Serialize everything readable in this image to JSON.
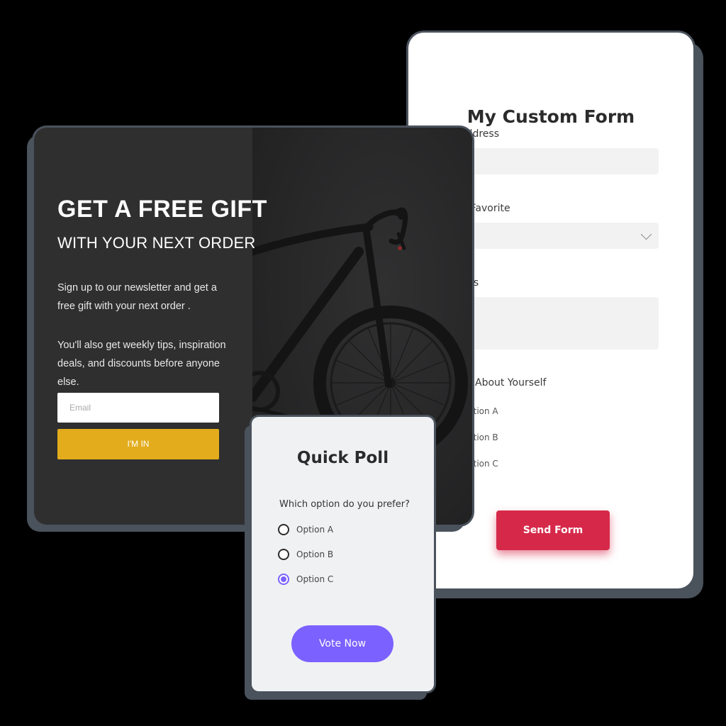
{
  "custom_form": {
    "title": "My Custom Form",
    "email_label": "il Address",
    "favorite_label": "our Favorite",
    "comments_label": "nents",
    "about_label": "About Yourself",
    "options": [
      "ption A",
      "ption B",
      "ption C"
    ],
    "send_label": "Send Form",
    "accent_color": "#d6294a"
  },
  "newsletter": {
    "title": "GET A FREE GIFT",
    "subtitle": "WITH YOUR NEXT ORDER",
    "paragraph_1": "Sign up to our newsletter and get  a free gift with your next order .",
    "paragraph_2": "You'll also get weekly tips, inspiration deals, and discounts before anyone else.",
    "email_placeholder": "Email",
    "button_label": "I'M IN",
    "image_icon": "bicycle-photo",
    "accent_color": "#e2ac1c"
  },
  "poll": {
    "title": "Quick Poll",
    "question": "Which option do you prefer?",
    "options": [
      {
        "label": "Option A",
        "selected": false
      },
      {
        "label": "Option B",
        "selected": false
      },
      {
        "label": "Option C",
        "selected": true
      }
    ],
    "vote_label": "Vote Now",
    "accent_color": "#7b61ff"
  }
}
